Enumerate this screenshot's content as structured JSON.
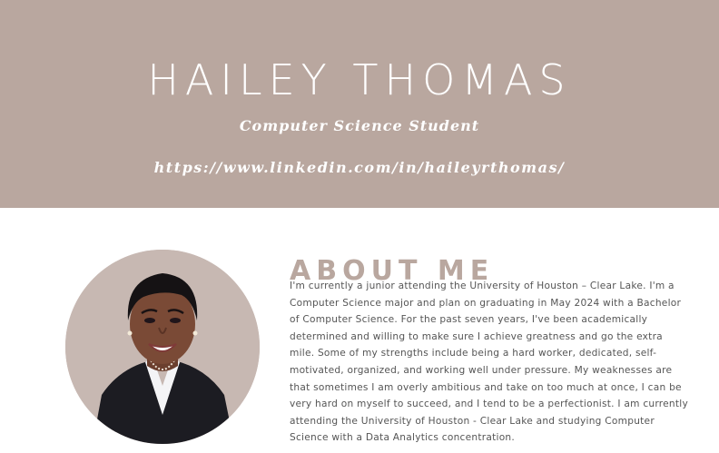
{
  "header": {
    "name": "HAILEY THOMAS",
    "subtitle": "Computer Science Student",
    "link": "https://www.linkedin.com/in/haileyrthomas/"
  },
  "about": {
    "title": "ABOUT ME",
    "text": "I'm currently a junior attending the University of Houston – Clear Lake. I'm a Computer Science major and plan on graduating in May 2024 with a Bachelor of Computer Science. For the past seven years, I've been academically determined and willing to make sure I achieve greatness and go the extra mile. Some of my strengths include being a hard worker, dedicated, self-motivated, organized, and working well under pressure. My weaknesses are that sometimes I am overly ambitious and take on too much at once, I can be very hard on myself to succeed, and I tend to be a perfectionist. I am currently attending the University of Houston - Clear Lake and studying Computer Science with a Data Analytics concentration."
  },
  "colors": {
    "hero_background": "#b9a79f",
    "accent": "#b9a79f",
    "body_text": "#555555"
  }
}
